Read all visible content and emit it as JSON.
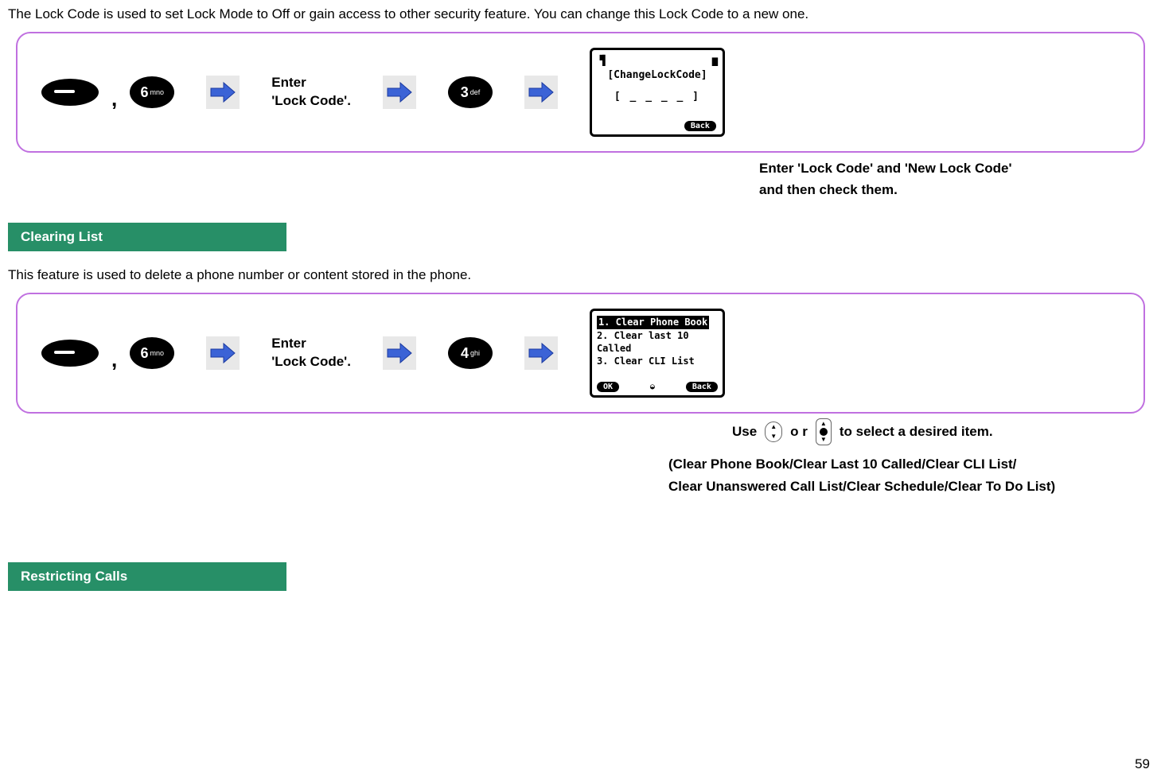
{
  "intro_text": "The Lock Code is used to set Lock Mode to Off or gain access to other security feature. You can change this Lock Code to a new one.",
  "panel1": {
    "key_menu_label": "menu",
    "key_num_big": "6",
    "key_num_sub": "mno",
    "action_line1": "Enter",
    "action_line2": "'Lock Code'.",
    "key_num2_big": "3",
    "key_num2_sub": "def",
    "screen_title": "[ChangeLockCode]",
    "screen_entry": "[ _ _ _ _ ]",
    "screen_soft": "Back"
  },
  "below1_line1": "Enter 'Lock Code' and 'New Lock Code'",
  "below1_line2": "and then check them.",
  "section2_title": "Clearing List",
  "section2_intro": "This feature is used to delete a phone number or content stored in the phone.",
  "panel2": {
    "key_num_big": "6",
    "key_num_sub": "mno",
    "action_line1": "Enter",
    "action_line2": "'Lock Code'.",
    "key_num2_big": "4",
    "key_num2_sub": "ghi",
    "screen_item1": "1. Clear Phone Book",
    "screen_item2": "2. Clear last 10 Called",
    "screen_item3": "3. Clear CLI List",
    "screen_soft_left": "OK",
    "screen_soft_right": "Back"
  },
  "navrow": {
    "use": "Use",
    "or": "o r",
    "tail": "to select a desired item."
  },
  "below2_line1": "(Clear Phone Book/Clear Last 10 Called/Clear CLI List/",
  "below2_line2": "Clear Unanswered Call List/Clear Schedule/Clear To Do List)",
  "section3_title": "Restricting Calls",
  "page_number": "59"
}
